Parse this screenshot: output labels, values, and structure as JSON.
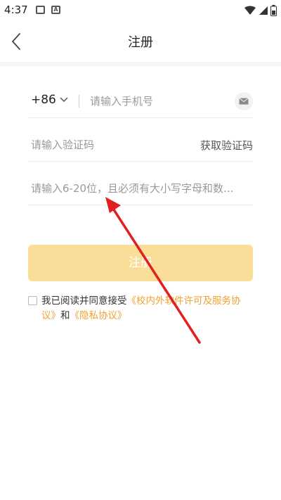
{
  "status_bar": {
    "time": "4:37",
    "icon_a_label": "A"
  },
  "header": {
    "title": "注册"
  },
  "phone": {
    "country_code": "+86",
    "placeholder": "请输入手机号"
  },
  "code": {
    "placeholder": "请输入验证码",
    "get_code_label": "获取验证码"
  },
  "password": {
    "placeholder": "请输入6-20位，且必须有大小写字母和数..."
  },
  "submit": {
    "label": "注册",
    "bg_color": "#fbdd9a"
  },
  "agreement": {
    "prefix": "我已阅读并同意接受",
    "link1": "《校内外软件许可及服务协议》",
    "middle": "和",
    "link2": "《隐私协议》",
    "link_color": "#f2a12e"
  },
  "annotation": {
    "color": "#e02020",
    "icon": "red-arrow-icon"
  }
}
